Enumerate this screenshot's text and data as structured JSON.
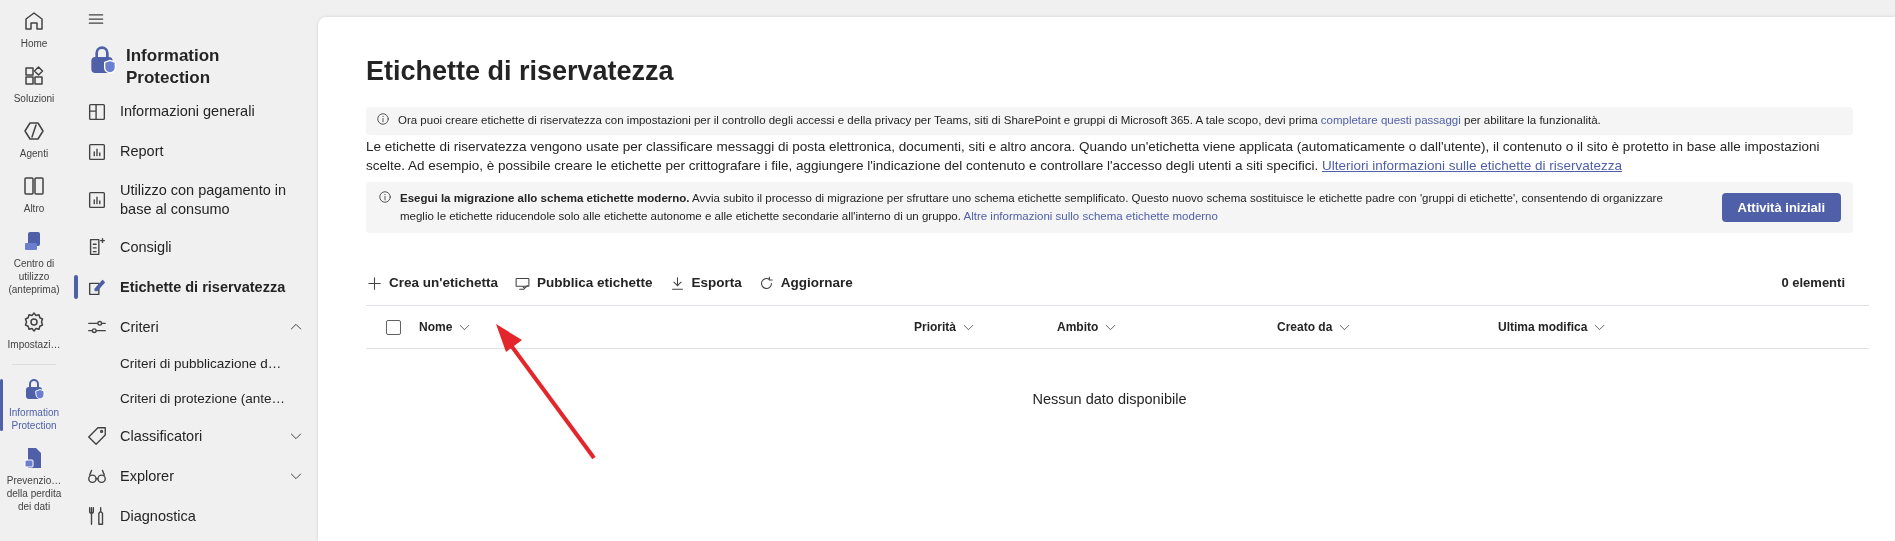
{
  "rail": {
    "items": [
      {
        "label": "Home",
        "selected": false
      },
      {
        "label": "Soluzioni",
        "selected": false
      },
      {
        "label": "Agenti",
        "selected": false
      },
      {
        "label": "Altro",
        "selected": false
      },
      {
        "label": "Centro di utilizzo (anteprima)",
        "selected": false
      },
      {
        "label": "Impostazi…",
        "selected": false
      },
      {
        "label": "Information Protection",
        "selected": true
      },
      {
        "label": "Prevenzio… della perdita dei dati",
        "selected": false
      }
    ]
  },
  "sidebar": {
    "title": "Information Protection",
    "items": [
      {
        "label": "Informazioni generali",
        "selected": false
      },
      {
        "label": "Report",
        "selected": false
      },
      {
        "label": "Utilizzo con pagamento in base al consumo",
        "selected": false
      },
      {
        "label": "Consigli",
        "selected": false
      },
      {
        "label": "Etichette di riservatezza",
        "selected": true
      },
      {
        "label": "Criteri",
        "selected": false,
        "expanded": true,
        "children": [
          {
            "label": "Criteri di pubblicazione d…",
            "selected": false
          },
          {
            "label": "Criteri di protezione (ante…",
            "selected": false
          }
        ]
      },
      {
        "label": "Classificatori",
        "selected": false,
        "expanded": false
      },
      {
        "label": "Explorer",
        "selected": false,
        "expanded": false
      },
      {
        "label": "Diagnostica",
        "selected": false
      }
    ]
  },
  "page": {
    "title": "Etichette di riservatezza",
    "notice": {
      "text": "Ora puoi creare etichette di riservatezza con impostazioni per il controllo degli accessi e della privacy per Teams, siti di SharePoint e gruppi di Microsoft 365. A tale scopo, devi prima",
      "link": "completare questi passaggi",
      "text_after": "per abilitare la funzionalità."
    },
    "description": {
      "text": "Le etichette di riservatezza vengono usate per classificare messaggi di posta elettronica, documenti, siti e altro ancora. Quando un'etichetta viene applicata (automaticamente o dall'utente), il contenuto o il sito è protetto in base alle impostazioni scelte. Ad esempio, è possibile creare le etichette per crittografare i file, aggiungere l'indicazione del contenuto e controllare l'accesso degli utenti a siti specifici.",
      "link": "Ulteriori informazioni sulle etichette di riservatezza"
    },
    "migration": {
      "text": "**Esegui la migrazione allo schema etichette moderno.** Avvia subito il processo di migrazione per sfruttare uno schema etichette semplificato. Questo nuovo schema sostituisce le etichette padre con 'gruppi di etichette', consentendo di organizzare meglio le etichette riducendole solo alle etichette autonome e alle etichette secondarie all'interno di un gruppo.",
      "link": "Altre informazioni sullo schema etichette moderno",
      "button": "Attività iniziali"
    },
    "toolbar": [
      "Crea un'etichetta",
      "Pubblica etichette",
      "Esporta",
      "Aggiornare"
    ],
    "count": "0 elementi",
    "table": {
      "select_all": {
        "checked": false
      },
      "columns": [
        "Nome",
        "Priorità",
        "Ambito",
        "Creato da",
        "Ultima modifica"
      ],
      "empty_message": "Nessun dato disponibile"
    }
  }
}
